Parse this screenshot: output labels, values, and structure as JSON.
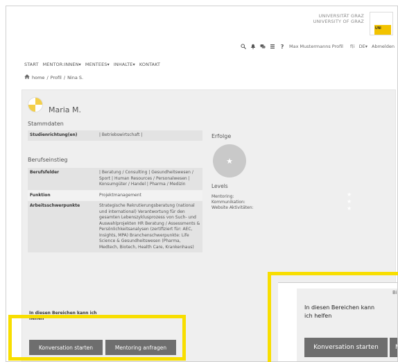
{
  "header": {
    "university_line1": "UNIVERSITÄT GRAZ",
    "university_line2": "UNIVERSITY OF GRAZ",
    "logo_text": "UNI"
  },
  "topbar": {
    "icons": [
      "search-icon",
      "bell-icon",
      "chat-icon",
      "list-icon",
      "help-icon"
    ],
    "user_label": "Max Mustermanns Profil",
    "lang_a": "f(i",
    "lang_b": "DE",
    "logout": "Abmelden"
  },
  "nav": {
    "items": [
      "START",
      "MENTOR:INNEN",
      "MENTEES",
      "INHALTE",
      "KONTAKT"
    ]
  },
  "breadcrumb": {
    "home": "home",
    "sep": "/",
    "profile": "Profil",
    "current": "Nina S."
  },
  "profile": {
    "name": "Maria M.",
    "stammdaten_heading": "Stammdaten",
    "berufseinstieg_heading": "Berufseinstieg",
    "stammdaten_rows": [
      {
        "key": "Studienrichtung(en)",
        "value": "| Betriebswirtschaft |"
      }
    ],
    "berufseinstieg_rows": [
      {
        "key": "Berufsfelder",
        "value": "| Beratung / Consulting | Gesundheitswesen / Sport | Human Resources / Personalwesen | Konsumgüter / Handel | Pharma / Medizin"
      },
      {
        "key": "Funktion",
        "value": "Projektmanagement"
      },
      {
        "key": "Arbeitsschwerpunkte",
        "value": "Strategische Rekrutierungsberatung (national und international) Verantwortung für den gesamten Lebenszyklusprozess von Such- und Auswahlprojekten HR Beratung / Assessments & Persönlichkeitsanalysen (zertifiziert für: AEC, Insights, MPA) Branchenschwerpunkte: Life Science & Gesundheitswesen (Pharma, Medtech, Biotech, Health Care, Krankenhaus)"
      }
    ],
    "helfen_label": "In diesen Bereichen kann ich helfen"
  },
  "achievements": {
    "erfolge": "Erfolge",
    "levels": "Levels",
    "level_items": [
      "Mentoring:",
      "Kommunikation:",
      "Website Aktivitäten:"
    ]
  },
  "actions": {
    "conversation": "Konversation starten",
    "mentoring": "Mentoring anfragen"
  },
  "inset": {
    "biot": "Biot",
    "helfen_label": "In diesen Bereichen kann ich helfen",
    "conversation": "Konversation starten",
    "mentoring_partial": "M"
  },
  "colors": {
    "highlight": "#f8de00",
    "button_bg": "#6e6e6e",
    "panel_bg": "#efefef",
    "logo_yellow": "#f2c300"
  }
}
